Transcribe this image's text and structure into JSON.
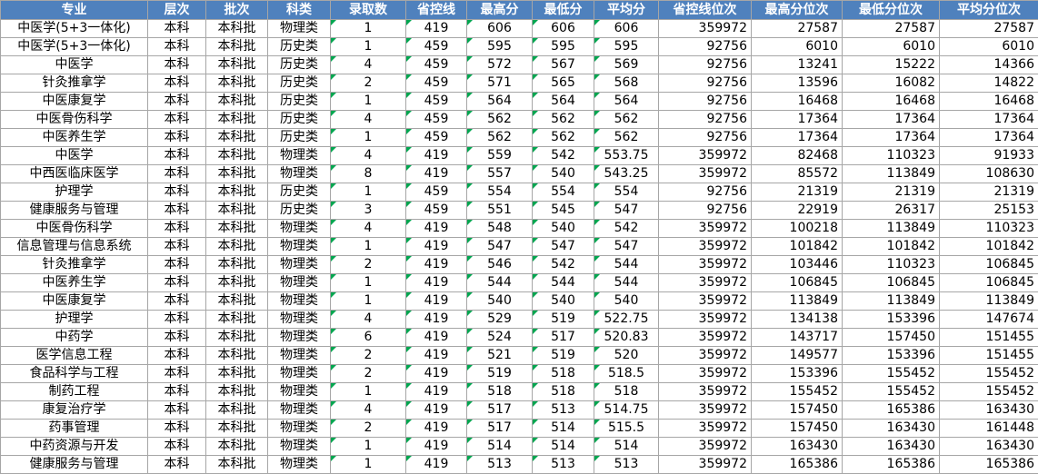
{
  "table": {
    "headers": [
      "专业",
      "层次",
      "批次",
      "科类",
      "录取数",
      "省控线",
      "最高分",
      "最低分",
      "平均分",
      "省控线位次",
      "最高分位次",
      "最低分位次",
      "平均分位次"
    ],
    "rows": [
      [
        "中医学(5+3一体化)",
        "本科",
        "本科批",
        "物理类",
        "1",
        "419",
        "606",
        "606",
        "606",
        "359972",
        "27587",
        "27587",
        "27587"
      ],
      [
        "中医学(5+3一体化)",
        "本科",
        "本科批",
        "历史类",
        "1",
        "459",
        "595",
        "595",
        "595",
        "92756",
        "6010",
        "6010",
        "6010"
      ],
      [
        "中医学",
        "本科",
        "本科批",
        "历史类",
        "4",
        "459",
        "572",
        "567",
        "569",
        "92756",
        "13241",
        "15222",
        "14366"
      ],
      [
        "针灸推拿学",
        "本科",
        "本科批",
        "历史类",
        "2",
        "459",
        "571",
        "565",
        "568",
        "92756",
        "13596",
        "16082",
        "14822"
      ],
      [
        "中医康复学",
        "本科",
        "本科批",
        "历史类",
        "1",
        "459",
        "564",
        "564",
        "564",
        "92756",
        "16468",
        "16468",
        "16468"
      ],
      [
        "中医骨伤科学",
        "本科",
        "本科批",
        "历史类",
        "4",
        "459",
        "562",
        "562",
        "562",
        "92756",
        "17364",
        "17364",
        "17364"
      ],
      [
        "中医养生学",
        "本科",
        "本科批",
        "历史类",
        "1",
        "459",
        "562",
        "562",
        "562",
        "92756",
        "17364",
        "17364",
        "17364"
      ],
      [
        "中医学",
        "本科",
        "本科批",
        "物理类",
        "4",
        "419",
        "559",
        "542",
        "553.75",
        "359972",
        "82468",
        "110323",
        "91933"
      ],
      [
        "中西医临床医学",
        "本科",
        "本科批",
        "物理类",
        "8",
        "419",
        "557",
        "540",
        "543.25",
        "359972",
        "85572",
        "113849",
        "108630"
      ],
      [
        "护理学",
        "本科",
        "本科批",
        "历史类",
        "1",
        "459",
        "554",
        "554",
        "554",
        "92756",
        "21319",
        "21319",
        "21319"
      ],
      [
        "健康服务与管理",
        "本科",
        "本科批",
        "历史类",
        "3",
        "459",
        "551",
        "545",
        "547",
        "92756",
        "22919",
        "26317",
        "25153"
      ],
      [
        "中医骨伤科学",
        "本科",
        "本科批",
        "物理类",
        "4",
        "419",
        "548",
        "540",
        "542",
        "359972",
        "100218",
        "113849",
        "110323"
      ],
      [
        "信息管理与信息系统",
        "本科",
        "本科批",
        "物理类",
        "1",
        "419",
        "547",
        "547",
        "547",
        "359972",
        "101842",
        "101842",
        "101842"
      ],
      [
        "针灸推拿学",
        "本科",
        "本科批",
        "物理类",
        "2",
        "419",
        "546",
        "542",
        "544",
        "359972",
        "103446",
        "110323",
        "106845"
      ],
      [
        "中医养生学",
        "本科",
        "本科批",
        "物理类",
        "1",
        "419",
        "544",
        "544",
        "544",
        "359972",
        "106845",
        "106845",
        "106845"
      ],
      [
        "中医康复学",
        "本科",
        "本科批",
        "物理类",
        "1",
        "419",
        "540",
        "540",
        "540",
        "359972",
        "113849",
        "113849",
        "113849"
      ],
      [
        "护理学",
        "本科",
        "本科批",
        "物理类",
        "4",
        "419",
        "529",
        "519",
        "522.75",
        "359972",
        "134138",
        "153396",
        "147674"
      ],
      [
        "中药学",
        "本科",
        "本科批",
        "物理类",
        "6",
        "419",
        "524",
        "517",
        "520.83",
        "359972",
        "143717",
        "157450",
        "151455"
      ],
      [
        "医学信息工程",
        "本科",
        "本科批",
        "物理类",
        "2",
        "419",
        "521",
        "519",
        "520",
        "359972",
        "149577",
        "153396",
        "151455"
      ],
      [
        "食品科学与工程",
        "本科",
        "本科批",
        "物理类",
        "2",
        "419",
        "519",
        "518",
        "518.5",
        "359972",
        "153396",
        "155452",
        "155452"
      ],
      [
        "制药工程",
        "本科",
        "本科批",
        "物理类",
        "1",
        "419",
        "518",
        "518",
        "518",
        "359972",
        "155452",
        "155452",
        "155452"
      ],
      [
        "康复治疗学",
        "本科",
        "本科批",
        "物理类",
        "4",
        "419",
        "517",
        "513",
        "514.75",
        "359972",
        "157450",
        "165386",
        "163430"
      ],
      [
        "药事管理",
        "本科",
        "本科批",
        "物理类",
        "2",
        "419",
        "517",
        "514",
        "515.5",
        "359972",
        "157450",
        "163430",
        "161448"
      ],
      [
        "中药资源与开发",
        "本科",
        "本科批",
        "物理类",
        "1",
        "419",
        "514",
        "514",
        "514",
        "359972",
        "163430",
        "163430",
        "163430"
      ],
      [
        "健康服务与管理",
        "本科",
        "本科批",
        "物理类",
        "1",
        "419",
        "513",
        "513",
        "513",
        "359972",
        "165386",
        "165386",
        "165386"
      ]
    ]
  },
  "colors": {
    "header_bg": "#4f81bd",
    "header_text": "#ffffff",
    "grid": "#a6a6a6",
    "flag": "#00a650"
  }
}
